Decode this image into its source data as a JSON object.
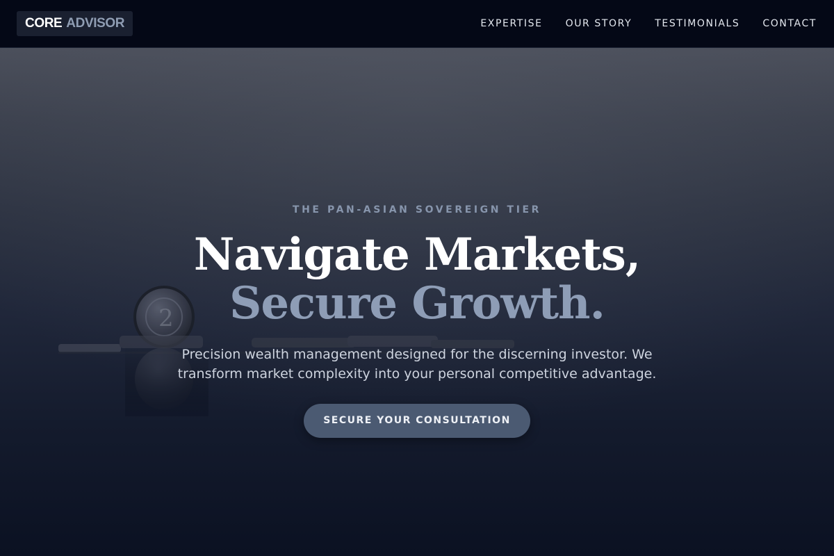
{
  "brand": {
    "word1": "CORE",
    "word2": "ADVISOR"
  },
  "nav": {
    "items": [
      "EXPERTISE",
      "OUR STORY",
      "TESTIMONIALS",
      "CONTACT"
    ]
  },
  "hero": {
    "eyebrow": "THE PAN-ASIAN SOVEREIGN TIER",
    "headline_line1": "Navigate Markets,",
    "headline_line2": "Secure Growth.",
    "subtext": "Precision wealth management designed for the discerning investor. We transform market complexity into your personal competitive advantage.",
    "cta_label": "SECURE YOUR CONSULTATION",
    "background_image": "coin-reflection-photo"
  },
  "colors": {
    "nav_background": "#040816",
    "accent_slate": "#8e9db6",
    "cta_background": "#4b5a72",
    "hero_bottom": "#0b1122"
  }
}
